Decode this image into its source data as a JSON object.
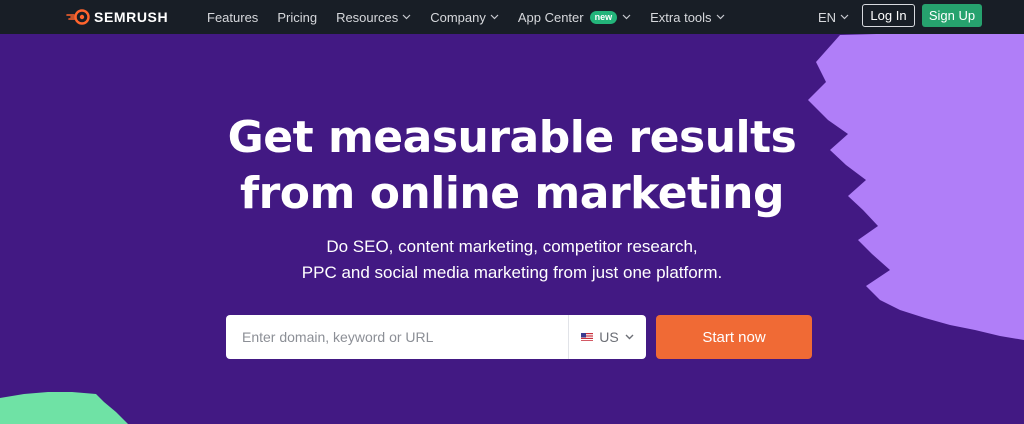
{
  "nav": {
    "brand": "SEMRUSH",
    "items": [
      {
        "label": "Features",
        "dropdown": false
      },
      {
        "label": "Pricing",
        "dropdown": false
      },
      {
        "label": "Resources",
        "dropdown": true
      },
      {
        "label": "Company",
        "dropdown": true
      },
      {
        "label": "App Center",
        "dropdown": true,
        "badge": "new"
      },
      {
        "label": "Extra tools",
        "dropdown": true
      }
    ],
    "language": "EN",
    "login_label": "Log In",
    "signup_label": "Sign Up"
  },
  "hero": {
    "title_line1": "Get measurable results",
    "title_line2": "from online marketing",
    "subtitle_line1": "Do SEO, content marketing, competitor research,",
    "subtitle_line2": "PPC and social media marketing from just one platform."
  },
  "search": {
    "placeholder": "Enter domain, keyword or URL",
    "value": "",
    "country": "US",
    "submit_label": "Start now"
  },
  "colors": {
    "nav_bg": "#181e26",
    "hero_bg": "#421983",
    "accent_orange": "#f06a35",
    "signup_green": "#26a26e",
    "deco_purple": "#b07ef8",
    "deco_green": "#6fe2a5"
  },
  "icons": {
    "brand": "semrush-fire-logo-icon",
    "dropdown": "chevron-down-icon",
    "country_flag": "us-flag-icon"
  }
}
